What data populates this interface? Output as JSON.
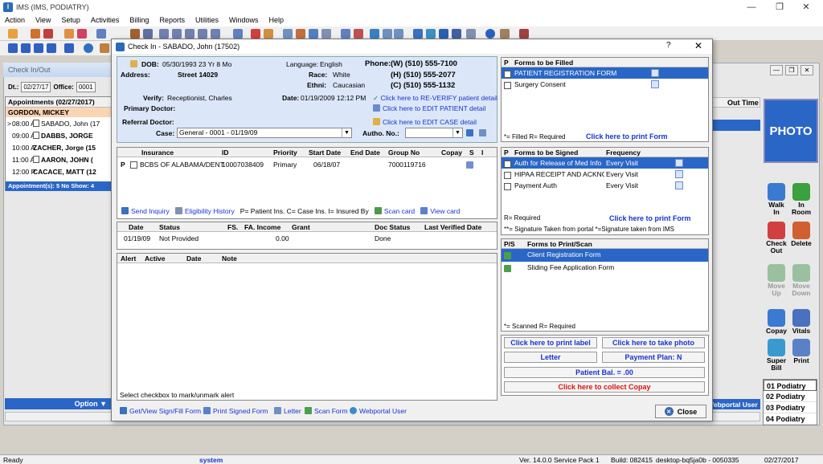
{
  "app": {
    "title": "IMS (IMS, PODIATRY)"
  },
  "menu": [
    "Action",
    "View",
    "Setup",
    "Activities",
    "Billing",
    "Reports",
    "Utilities",
    "Windows",
    "Help"
  ],
  "background": {
    "panel_title": "Check In/Out",
    "dt_label": "Dt.:",
    "dt_value": "02/27/17",
    "office_label": "Office:",
    "office_value": "0001",
    "appointments_header": "Appointments (02/27/2017)",
    "highlight_patient": "GORDON, MICKEY",
    "appointments": [
      {
        "time": "08:00 A",
        "name": "SABADO, John (17"
      },
      {
        "time": "09:00 A",
        "name": "DABBS, JORGE"
      },
      {
        "time": "10:00 A",
        "name": "ZACHER, Jorge (15"
      },
      {
        "time": "11:00 A",
        "name": "AARON, JOHN ("
      },
      {
        "time": "12:00 P",
        "name": "CACACE, MATT (12"
      }
    ],
    "appointments_footer": "Appointment(s): 5   No Show: 4",
    "options_label": "Option",
    "col_ne": "ne",
    "col_out_time": "Out Time",
    "webportal_user": "Webportal User",
    "photo_label": "PHOTO",
    "side_buttons": [
      {
        "label": "Walk\nIn",
        "color": "#3a7ad0"
      },
      {
        "label": "In\nRoom",
        "color": "#3aa040"
      },
      {
        "label": "Check\nOut",
        "color": "#d04040"
      },
      {
        "label": "Delete",
        "color": "#d06030"
      },
      {
        "label": "Move\nUp",
        "color": "#9ac0a0"
      },
      {
        "label": "Move\nDown",
        "color": "#9ac0a0"
      },
      {
        "label": "Copay",
        "color": "#3a7ad0"
      },
      {
        "label": "Vitals",
        "color": "#4a70c0"
      },
      {
        "label": "Super\nBill",
        "color": "#3a9ad0"
      },
      {
        "label": "Print",
        "color": "#5a80c8"
      }
    ],
    "podiatry_list": [
      "01 Podiatry",
      "02 Podiatry",
      "03 Podiatry",
      "04 Podiatry"
    ]
  },
  "statusbar": {
    "ready": "Ready",
    "user": "system",
    "version": "Ver. 14.0.0 Service Pack 1",
    "build": "Build: 082415",
    "machine": "desktop-bq5ja0b - 0050335",
    "date": "02/27/2017"
  },
  "dialog": {
    "title": "Check In - SABADO, John  (17502)",
    "help": "?",
    "dob_label": "DOB:",
    "dob_value": "05/30/1993  23 Yr 8 Mo",
    "address_label": "Address:",
    "address_value": "Street 14029",
    "language_label": "Language:",
    "language_value": "English",
    "phone_label": "Phone:",
    "phone_w": "(W)  (510) 555-7100",
    "phone_h": "(H)  (510) 555-2077",
    "phone_c": "(C)  (510) 555-1132",
    "race_label": "Race:",
    "race_value": "White",
    "ethni_label": "Ethni:",
    "ethni_value": "Caucasian",
    "verify_label": "Verify:",
    "verify_value": "Receptionist, Charles",
    "date_label": "Date:",
    "date_value": "01/19/2009 12:12 PM",
    "reverify_link": "Click here to RE-VERIFY patient detail",
    "primary_doctor_label": "Primary Doctor:",
    "edit_patient_link": "Click here to EDIT PATIENT detail",
    "referral_doctor_label": "Referral Doctor:",
    "edit_case_link": "Click here to EDIT CASE detail",
    "case_label": "Case:",
    "case_value": "General  -  0001 - 01/19/09",
    "autho_label": "Autho. No.:",
    "insurance": {
      "columns": [
        "Insurance",
        "ID",
        "Priority",
        "Start Date",
        "End Date",
        "Group No",
        "Copay",
        "S",
        "I"
      ],
      "rows": [
        {
          "type": "P",
          "insurance": "BCBS OF ALABAMA/DENT",
          "id": "10007038409",
          "priority": "Primary",
          "start": "06/18/07",
          "end": "",
          "group": "7000119716",
          "copay": ""
        }
      ],
      "links": {
        "send_inquiry": "Send Inquiry",
        "eligibility_history": "Eligibility History",
        "legend": "P= Patient Ins.  C= Case Ins.  I= Insured By",
        "scan_card": "Scan card",
        "view_card": "View card"
      }
    },
    "fs_grid": {
      "columns": [
        "Date",
        "Status",
        "FS.",
        "FA. Income",
        "Grant",
        "Doc Status",
        "Last Verified Date"
      ],
      "rows": [
        {
          "date": "01/19/09",
          "status": "Not Provided",
          "fs": "",
          "income": "0.00",
          "grant": "",
          "doc_status": "Done",
          "last_verified": ""
        }
      ]
    },
    "alert_grid": {
      "columns": [
        "Alert",
        "Active",
        "Date",
        "Note"
      ],
      "footer": "Select checkbox to mark/unmark alert"
    },
    "forms_to_fill": {
      "col_p": "P",
      "title": "Forms to be Filled",
      "items": [
        "PATIENT REGISTRATION FORM",
        "Surgery Consent"
      ],
      "legend": "*= Filled   R= Required",
      "print_link": "Click here to print Form"
    },
    "forms_to_sign": {
      "col_p": "P",
      "title": "Forms to be Signed",
      "frequency_label": "Frequency",
      "items": [
        {
          "name": "Auth for Release of Med Info",
          "freq": "Every Visit"
        },
        {
          "name": "HIPAA RECEIPT AND ACKNOW",
          "freq": "Every Visit"
        },
        {
          "name": "Payment Auth",
          "freq": "Every Visit"
        }
      ],
      "legend1": "R= Required",
      "legend2": "**= Signature Taken from portal  *=Signature taken from IMS",
      "print_link": "Click here to print Form"
    },
    "forms_to_print": {
      "col_ps": "P/S",
      "title": "Forms to Print/Scan",
      "items": [
        "Client Registration Form",
        "Sliding Fee Application Form"
      ],
      "legend": "*= Scanned   R= Required"
    },
    "buttons": {
      "print_label": "Click here to print label",
      "take_photo": "Click here to take photo",
      "letter": "Letter",
      "payment_plan": "Payment Plan: N",
      "patient_bal": "Patient Bal. = .00",
      "collect_copay": "Click here to collect Copay"
    },
    "bottom_links": {
      "get_view_sign": "Get/View Sign/Fill Form",
      "print_signed": "Print Signed Form",
      "letter": "Letter",
      "scan_form": "Scan Form",
      "webportal_user": "Webportal User"
    },
    "close_label": "Close"
  }
}
